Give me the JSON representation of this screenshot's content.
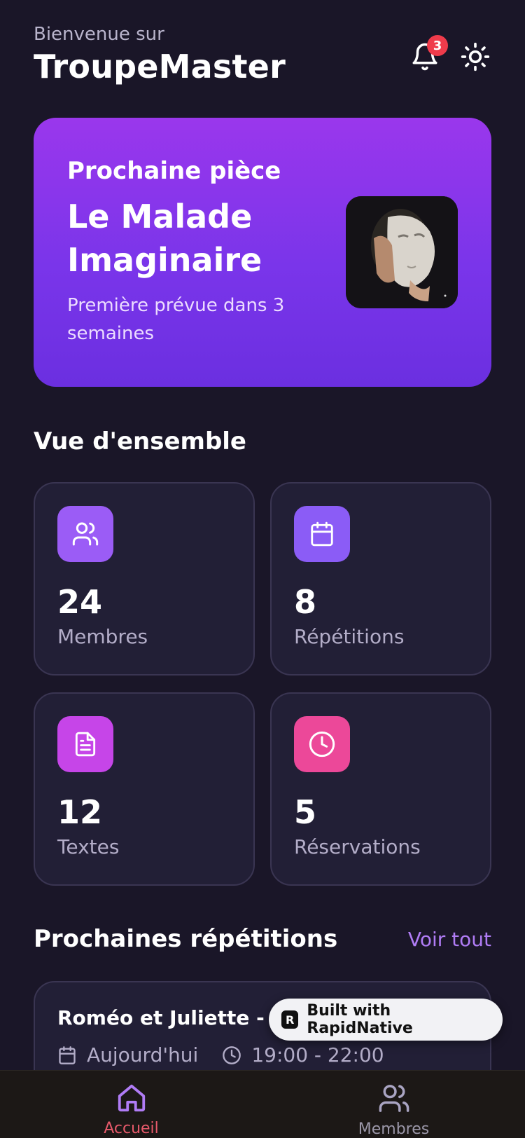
{
  "header": {
    "welcome": "Bienvenue sur",
    "app_title": "TroupeMaster",
    "notifications_count": "3",
    "icons": [
      "bell-icon",
      "sun-icon"
    ]
  },
  "hero": {
    "label": "Prochaine pièce",
    "title": "Le Malade Imaginaire",
    "subtitle": "Première prévue dans 3 semaines",
    "colors": {
      "gradient_start": "#9a37ec",
      "gradient_end": "#6b2fe0"
    }
  },
  "overview": {
    "title": "Vue d'ensemble",
    "stats": [
      {
        "value": "24",
        "label": "Membres",
        "icon": "users-icon",
        "color": "#9b5cf6"
      },
      {
        "value": "8",
        "label": "Répétitions",
        "icon": "calendar-icon",
        "color": "#8b5cf6"
      },
      {
        "value": "12",
        "label": "Textes",
        "icon": "document-icon",
        "color": "#c645e8"
      },
      {
        "value": "5",
        "label": "Réservations",
        "icon": "clock-icon",
        "color": "#ec4899"
      }
    ]
  },
  "rehearsals": {
    "title": "Prochaines répétitions",
    "see_all": "Voir tout",
    "items": [
      {
        "title": "Roméo et Juliette - Ac",
        "date": "Aujourd'hui",
        "time": "19:00 - 22:00"
      }
    ]
  },
  "built_with": {
    "label": "Built with RapidNative"
  },
  "tabbar": {
    "tabs": [
      {
        "label": "Accueil",
        "icon": "home-icon",
        "active": true
      },
      {
        "label": "Membres",
        "icon": "users-icon",
        "active": false
      }
    ],
    "active_color": "#e85a6b"
  }
}
